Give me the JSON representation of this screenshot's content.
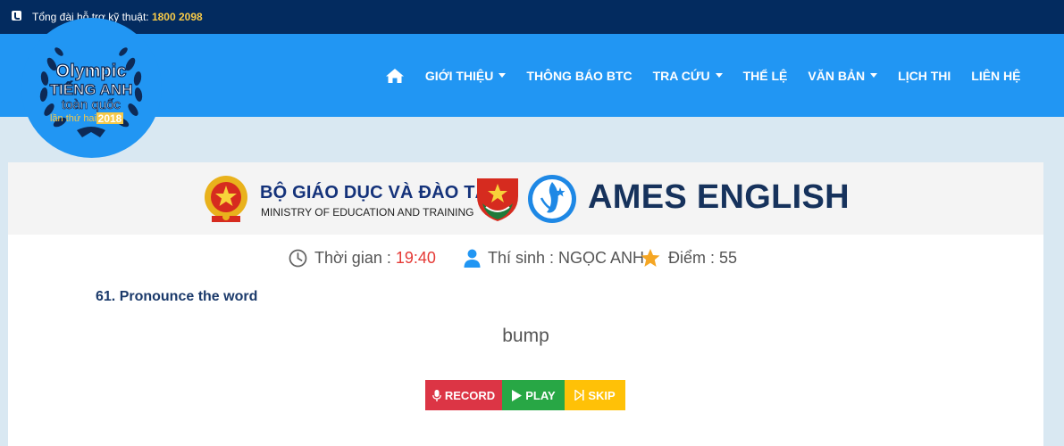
{
  "topbar": {
    "hotline_label": "Tổng đài hỗ trợ kỹ thuật:",
    "hotline_number": "1800 2098"
  },
  "logo": {
    "line1": "Olympic",
    "line2": "TIẾNG ANH",
    "line3": "toàn quốc",
    "line4": "lần thứ hai",
    "year": "2018"
  },
  "nav": {
    "items": [
      {
        "label": "GIỚI THIỆU",
        "dropdown": true
      },
      {
        "label": "THÔNG BÁO BTC",
        "dropdown": false
      },
      {
        "label": "TRA CỨU",
        "dropdown": true
      },
      {
        "label": "THỂ LỆ",
        "dropdown": false
      },
      {
        "label": "VĂN BẢN",
        "dropdown": true
      },
      {
        "label": "LỊCH THI",
        "dropdown": false
      },
      {
        "label": "LIÊN HỆ",
        "dropdown": false
      }
    ]
  },
  "banner": {
    "ministry_vn": "BỘ GIÁO DỤC VÀ ĐÀO TẠO",
    "ministry_en": "MINISTRY OF EDUCATION AND TRAINING",
    "brand": "AMES ENGLISH"
  },
  "info": {
    "time_label": "Thời gian :",
    "time_value": "19:40",
    "candidate_label": "Thí sinh :",
    "candidate_name": "NGỌC ANH",
    "score_label": "Điểm :",
    "score_value": "55"
  },
  "question": {
    "text": "61. Pronounce the word",
    "word": "bump"
  },
  "controls": {
    "record_label": "RECORD",
    "play_label": "PLAY",
    "skip_label": "SKIP"
  },
  "colors": {
    "topbar": "#032b5f",
    "nav": "#2196f3",
    "accent_yellow": "#f7c948",
    "record": "#dc3545",
    "play": "#28a745",
    "skip": "#ffc107"
  }
}
